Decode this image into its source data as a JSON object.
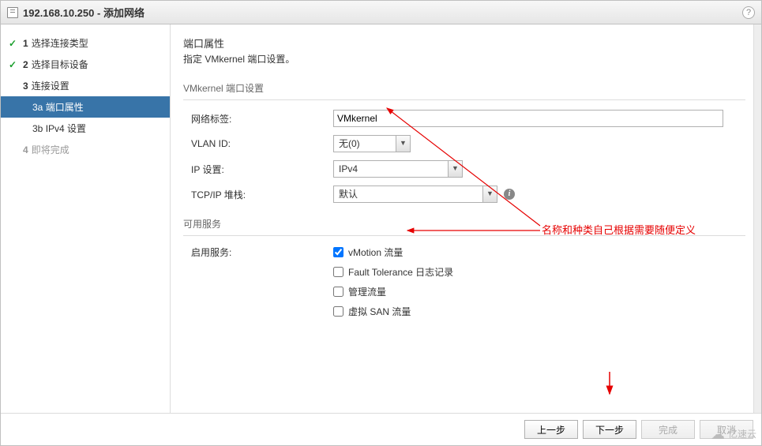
{
  "titlebar": {
    "host": "192.168.10.250",
    "title": "添加网络",
    "separator": " - "
  },
  "sidebar": {
    "steps": [
      {
        "num": "1",
        "label": "选择连接类型",
        "done": true
      },
      {
        "num": "2",
        "label": "选择目标设备",
        "done": true
      },
      {
        "num": "3",
        "label": "连接设置",
        "done": false
      },
      {
        "num": "4",
        "label": "即将完成",
        "done": false,
        "disabled": true
      }
    ],
    "substeps": [
      {
        "code": "3a",
        "label": "端口属性",
        "active": true
      },
      {
        "code": "3b",
        "label": "IPv4 设置",
        "active": false
      }
    ]
  },
  "content": {
    "header_title": "端口属性",
    "header_desc": "指定 VMkernel 端口设置。",
    "group_title": "VMkernel 端口设置",
    "form": {
      "network_label_lbl": "网络标签:",
      "network_label_value": "VMkernel",
      "vlan_lbl": "VLAN ID:",
      "vlan_value": "无(0)",
      "ip_lbl": "IP 设置:",
      "ip_value": "IPv4",
      "stack_lbl": "TCP/IP 堆栈:",
      "stack_value": "默认"
    },
    "services_title": "可用服务",
    "enable_services_lbl": "启用服务:",
    "services": [
      {
        "label": "vMotion 流量",
        "checked": true
      },
      {
        "label": "Fault Tolerance 日志记录",
        "checked": false
      },
      {
        "label": "管理流量",
        "checked": false
      },
      {
        "label": "虚拟 SAN 流量",
        "checked": false
      }
    ]
  },
  "footer": {
    "back": "上一步",
    "next": "下一步",
    "finish": "完成",
    "cancel": "取消"
  },
  "annotation": {
    "text": "名称和种类自己根据需要随便定义"
  },
  "watermark": "亿速云",
  "colors": {
    "accent": "#3874a8",
    "anno": "#e60000",
    "check": "#1a9f2c"
  }
}
